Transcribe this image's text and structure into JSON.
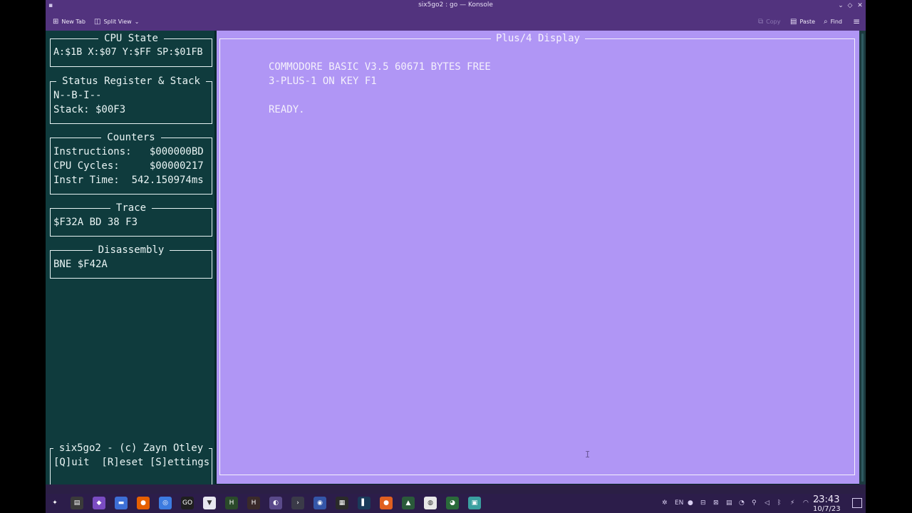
{
  "window": {
    "title": "six5go2 : go — Konsole"
  },
  "toolbar": {
    "new_tab": "New Tab",
    "split_view": "Split View",
    "copy": "Copy",
    "paste": "Paste",
    "find": "Find"
  },
  "panels": {
    "cpu_state": {
      "title": "CPU State",
      "line": "A:$1B X:$07 Y:$FF SP:$01FB"
    },
    "status": {
      "title": "Status Register & Stack",
      "flags": "N--B-I--",
      "stack": "Stack: $00F3"
    },
    "counters": {
      "title": "Counters",
      "instructions": "Instructions:   $000000BD",
      "cycles": "CPU Cycles:     $00000217",
      "time": "Instr Time:  542.150974ms"
    },
    "trace": {
      "title": "Trace",
      "line": "$F32A BD 38 F3"
    },
    "disassembly": {
      "title": "Disassembly",
      "line": "BNE $F42A"
    },
    "footer": {
      "title": "six5go2 - (c) Zayn Otley",
      "keys": "[Q]uit  [R]eset [S]ettings"
    }
  },
  "display": {
    "title": "Plus/4 Display",
    "lines": [
      "COMMODORE BASIC V3.5 60671 BYTES FREE",
      "3-PLUS-1 ON KEY F1",
      "READY."
    ],
    "background_color": "#b096f5"
  },
  "taskbar": {
    "apps": [
      {
        "name": "application-launcher-icon",
        "color": "#2c1d4a",
        "glyph": "✦"
      },
      {
        "name": "task-manager-icon",
        "color": "#3a3a3a",
        "glyph": "▤"
      },
      {
        "name": "store-icon",
        "color": "#7a4cc2",
        "glyph": "◆"
      },
      {
        "name": "file-manager-icon",
        "color": "#3d6fd6",
        "glyph": "▬"
      },
      {
        "name": "firefox-icon",
        "color": "#e66000",
        "glyph": "●"
      },
      {
        "name": "chromium-icon",
        "color": "#3c7be0",
        "glyph": "◎"
      },
      {
        "name": "goland-icon",
        "color": "#1f1f1f",
        "glyph": "GO"
      },
      {
        "name": "proton-vpn-icon",
        "color": "#e8e8f0",
        "glyph": "▼"
      },
      {
        "name": "hex-dune-icon",
        "color": "#2a4a2a",
        "glyph": "H"
      },
      {
        "name": "hex-dune-2-icon",
        "color": "#3a2a2a",
        "glyph": "H"
      },
      {
        "name": "blender-icon",
        "color": "#5a4a8a",
        "glyph": "◐"
      },
      {
        "name": "konsole-icon",
        "color": "#3a3a48",
        "glyph": "›"
      },
      {
        "name": "screen-recorder-icon",
        "color": "#3456a8",
        "glyph": "◉"
      },
      {
        "name": "notes-icon",
        "color": "#2a2a2a",
        "glyph": "▦"
      },
      {
        "name": "editor-icon",
        "color": "#1a3a5a",
        "glyph": "▌"
      },
      {
        "name": "firefox-dev-icon",
        "color": "#e06020",
        "glyph": "●"
      },
      {
        "name": "system-monitor-icon",
        "color": "#2a5a3a",
        "glyph": "▲"
      },
      {
        "name": "obs-icon",
        "color": "#e8e8e8",
        "glyph": "◍"
      },
      {
        "name": "globe-icon",
        "color": "#2a6a3a",
        "glyph": "◕"
      },
      {
        "name": "image-viewer-icon",
        "color": "#3aa0a0",
        "glyph": "▣"
      }
    ],
    "tray": [
      {
        "name": "bluetooth-settings-icon",
        "glyph": "✲"
      },
      {
        "name": "keyboard-layout-label",
        "glyph": "EN"
      },
      {
        "name": "record-icon",
        "glyph": "●"
      },
      {
        "name": "minus-box-icon",
        "glyph": "⊟"
      },
      {
        "name": "cross-box-icon",
        "glyph": "⊠"
      },
      {
        "name": "clipboard-icon",
        "glyph": "▤"
      },
      {
        "name": "updates-icon",
        "glyph": "◔"
      },
      {
        "name": "location-icon",
        "glyph": "⚲"
      },
      {
        "name": "volume-icon",
        "glyph": "◁"
      },
      {
        "name": "bluetooth-icon",
        "glyph": "ᛒ"
      },
      {
        "name": "power-icon",
        "glyph": "⚡"
      },
      {
        "name": "wifi-icon",
        "glyph": "◠"
      },
      {
        "name": "expand-tray-icon",
        "glyph": "^"
      }
    ],
    "time": "23:43",
    "date": "10/7/23"
  }
}
